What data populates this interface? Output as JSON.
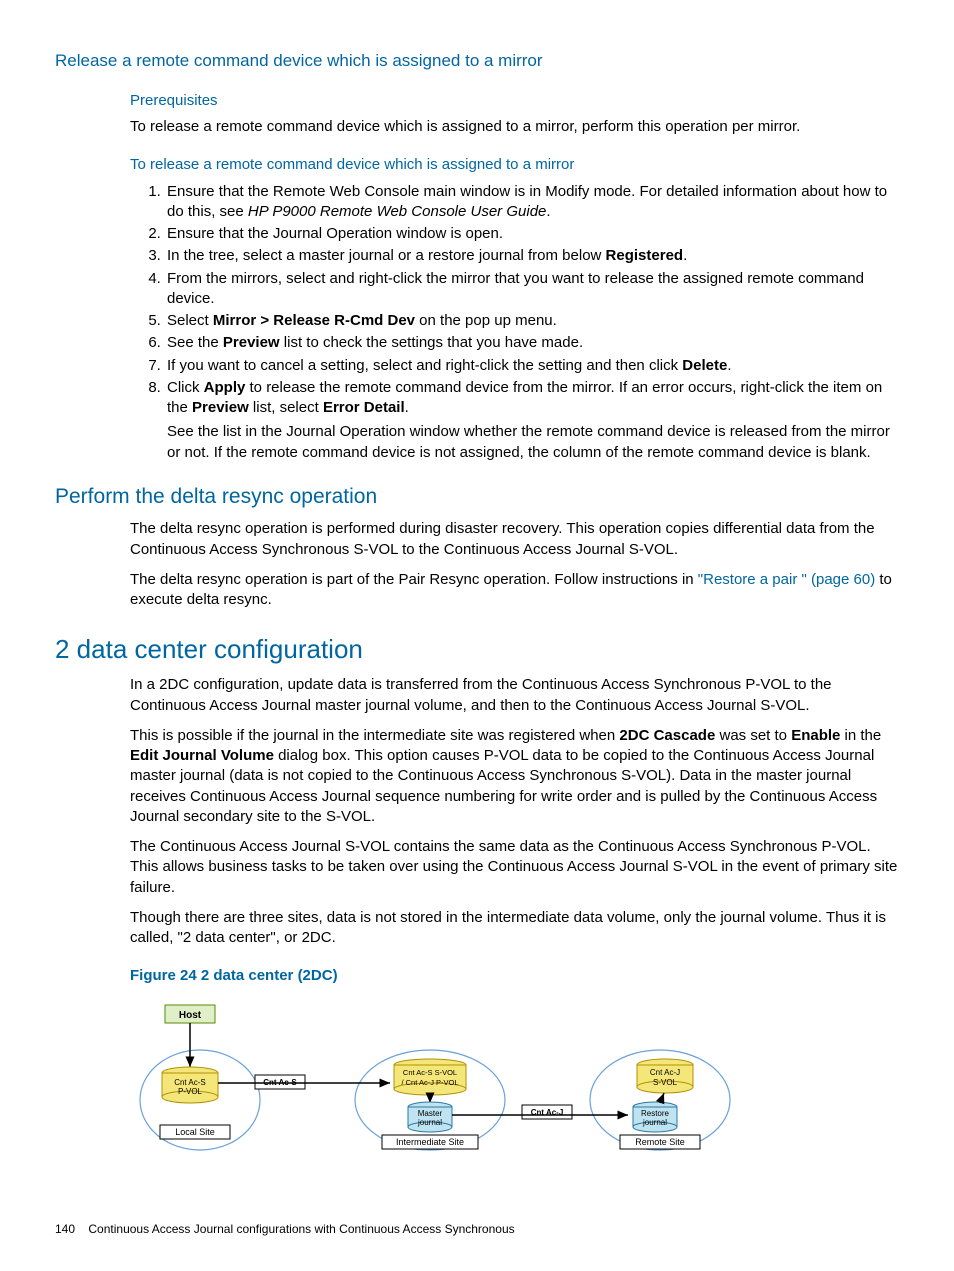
{
  "sec1": {
    "title": "Release a remote command device which is assigned to a mirror",
    "prereq_h": "Prerequisites",
    "prereq_p": "To release a remote command device which is assigned to a mirror, perform this operation per mirror.",
    "proc_h": "To release a remote command device which is assigned to a mirror",
    "steps": {
      "s1a": "Ensure that the Remote Web Console main window is in Modify mode. For detailed information about how to do this, see ",
      "s1b": "HP P9000 Remote Web Console User Guide",
      "s1c": ".",
      "s2": "Ensure that the Journal Operation window is open.",
      "s3a": "In the tree, select a master journal or a restore journal from below ",
      "s3b": "Registered",
      "s3c": ".",
      "s4": "From the mirrors, select and right-click the mirror that you want to release the assigned remote command device.",
      "s5a": "Select ",
      "s5b": "Mirror > Release R-Cmd Dev",
      "s5c": " on the pop up menu.",
      "s6a": "See the ",
      "s6b": "Preview",
      "s6c": " list to check the settings that you have made.",
      "s7a": "If you want to cancel a setting, select and right-click the setting and then click ",
      "s7b": "Delete",
      "s7c": ".",
      "s8a": "Click ",
      "s8b": "Apply",
      "s8c": " to release the remote command device from the mirror. If an error occurs, right-click the item on the ",
      "s8d": "Preview",
      "s8e": " list, select ",
      "s8f": "Error Detail",
      "s8g": ".",
      "s8sub": "See the list in the Journal Operation window whether the remote command device is released from the mirror or not. If the remote command device is not assigned, the column of the remote command device is blank."
    }
  },
  "sec2": {
    "title": "Perform the delta resync operation",
    "p1": "The delta resync operation is performed during disaster recovery. This operation copies differential data from the Continuous Access Synchronous S-VOL to the Continuous Access Journal S-VOL.",
    "p2a": "The delta resync operation is part of the Pair Resync operation. Follow instructions in ",
    "p2b": "\"Restore a pair \" (page 60)",
    "p2c": " to execute delta resync."
  },
  "sec3": {
    "title": "2 data center configuration",
    "p1": "In a 2DC configuration, update data is transferred from the Continuous Access Synchronous P-VOL to the Continuous Access Journal master journal volume, and then to the Continuous Access Journal S-VOL.",
    "p2a": "This is possible if the journal in the intermediate site was registered when ",
    "p2b": "2DC Cascade",
    "p2c": " was set to ",
    "p2d": "Enable",
    "p2e": " in the ",
    "p2f": "Edit Journal Volume",
    "p2g": " dialog box. This option causes P-VOL data to be copied to the Continuous Access Journal master journal (data is not copied to the Continuous Access Synchronous S-VOL). Data in the master journal receives Continuous Access Journal sequence numbering for write order and is pulled by the Continuous Access Journal secondary site to the S-VOL.",
    "p3": "The Continuous Access Journal S-VOL contains the same data as the Continuous Access Synchronous P-VOL. This allows business tasks to be taken over using the Continuous Access Journal S-VOL in the event of primary site failure.",
    "p4": "Though there are three sites, data is not stored in the intermediate data volume, only the journal volume. Thus it is called, \"2 data center\", or 2DC.",
    "fig_caption": "Figure 24 2 data center (2DC)"
  },
  "diagram": {
    "host": "Host",
    "cnt_ac_s_pvol_l1": "Cnt Ac-S",
    "cnt_ac_s_pvol_l2": "P-VOL",
    "local_site": "Local Site",
    "cnt_ac_s_label": "Cnt Ac-S",
    "mid_vol_l1": "Cnt Ac-S S-VOL",
    "mid_vol_l2": "/ Cnt Ac-J P-VOL",
    "master_l1": "Master",
    "master_l2": "journal",
    "intermediate_site": "Intermediate Site",
    "cnt_ac_j_label": "Cnt Ac-J",
    "svol_l1": "Cnt Ac-J",
    "svol_l2": "S-VOL",
    "restore_l1": "Restore",
    "restore_l2": "journal",
    "remote_site": "Remote Site"
  },
  "footer": {
    "page": "140",
    "text": "Continuous Access Journal configurations with Continuous Access Synchronous"
  }
}
